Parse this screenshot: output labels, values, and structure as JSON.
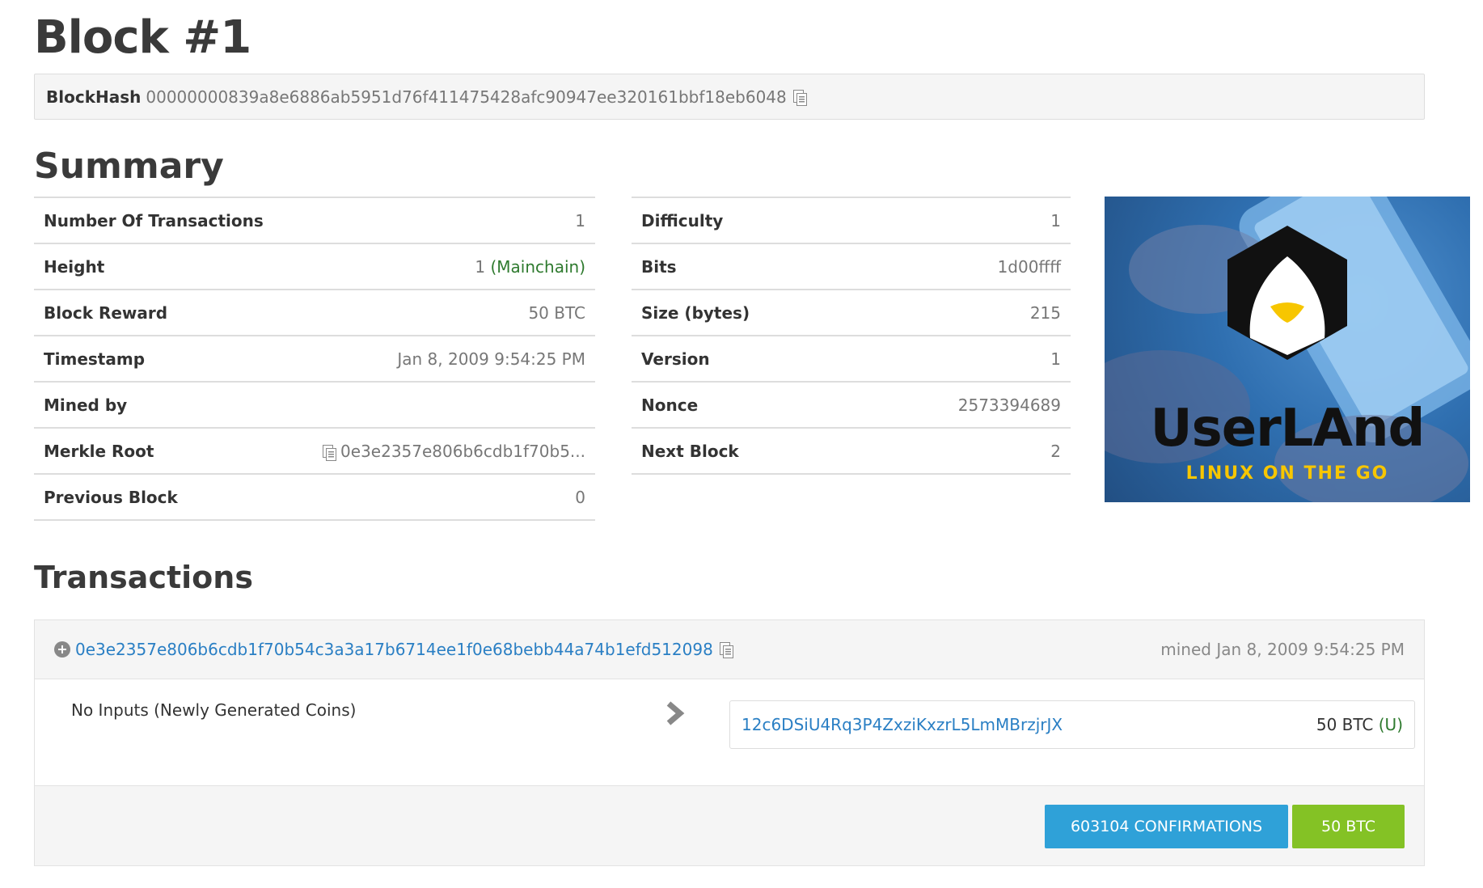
{
  "page_title": "Block #1",
  "blockhash": {
    "label": "BlockHash",
    "value": "00000000839a8e6886ab5951d76f411475428afc90947ee320161bbf18eb6048"
  },
  "summary": {
    "title": "Summary",
    "left_rows": [
      {
        "label": "Number Of Transactions",
        "value": "1"
      },
      {
        "label": "Height",
        "value": "1",
        "extra": "(Mainchain)"
      },
      {
        "label": "Block Reward",
        "value": "50 BTC"
      },
      {
        "label": "Timestamp",
        "value": "Jan 8, 2009 9:54:25 PM"
      },
      {
        "label": "Mined by",
        "value": ""
      },
      {
        "label": "Merkle Root",
        "value": "0e3e2357e806b6cdb1f70b5..."
      },
      {
        "label": "Previous Block",
        "value": "0"
      }
    ],
    "right_rows": [
      {
        "label": "Difficulty",
        "value": "1"
      },
      {
        "label": "Bits",
        "value": "1d00ffff"
      },
      {
        "label": "Size (bytes)",
        "value": "215"
      },
      {
        "label": "Version",
        "value": "1"
      },
      {
        "label": "Nonce",
        "value": "2573394689"
      },
      {
        "label": "Next Block",
        "value": "2"
      }
    ]
  },
  "ad": {
    "brand": "UserLAnd",
    "tagline": "LINUX ON THE GO"
  },
  "transactions": {
    "title": "Transactions",
    "tx": {
      "hash": "0e3e2357e806b6cdb1f70b54c3a3a17b6714ee1f0e68bebb44a74b1efd512098",
      "mined": "mined Jan 8, 2009 9:54:25 PM",
      "inputs_text": "No Inputs (Newly Generated Coins)",
      "output_address": "12c6DSiU4Rq3P4ZxziKxzrL5LmMBrzjrJX",
      "output_amount": "50 BTC",
      "output_flag": "(U)",
      "confirmations": "603104 CONFIRMATIONS",
      "total": "50 BTC"
    }
  },
  "colors": {
    "link": "#2a7fc4",
    "confirm_button": "#2fa1d8",
    "amount_button": "#84c225",
    "mainchain": "#2e7a2e"
  }
}
